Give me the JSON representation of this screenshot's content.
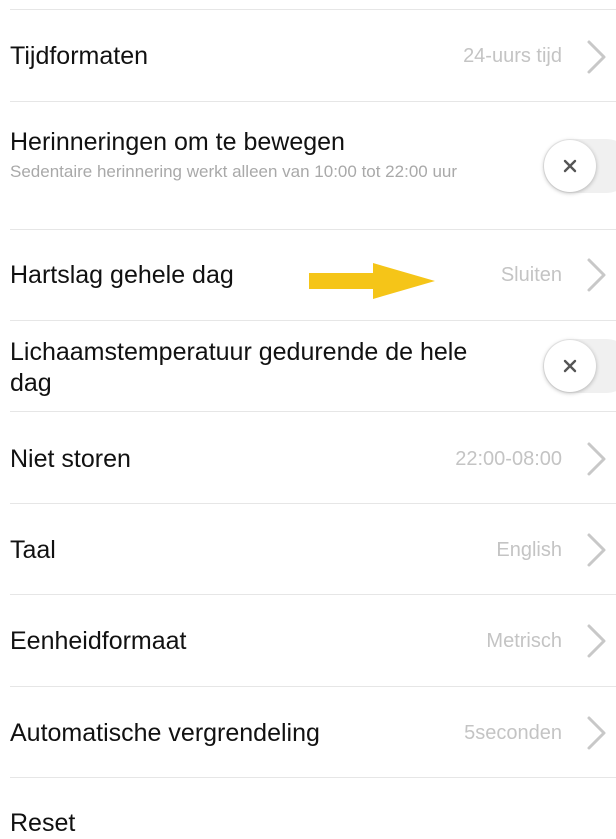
{
  "colors": {
    "accent_arrow": "#F5C518",
    "value_text": "#C4C4C4",
    "divider": "#E6E6E6",
    "toggle_bg": "#F0F0F0"
  },
  "settings": {
    "time_format": {
      "label": "Tijdformaten",
      "value": "24-uurs tijd"
    },
    "move_reminder": {
      "label": "Herinneringen om te bewegen",
      "sublabel": "Sedentaire herinnering werkt alleen van 10:00 tot 22:00 uur",
      "toggle": "off"
    },
    "heart_rate": {
      "label": "Hartslag gehele dag",
      "value": "Sluiten"
    },
    "body_temp": {
      "label": "Lichaamstemperatuur gedurende de hele dag",
      "toggle": "off"
    },
    "dnd": {
      "label": "Niet storen",
      "value": "22:00-08:00"
    },
    "language": {
      "label": "Taal",
      "value": "English"
    },
    "unit": {
      "label": "Eenheidformaat",
      "value": "Metrisch"
    },
    "autolock": {
      "label": "Automatische vergrendeling",
      "value": "5seconden"
    },
    "reset": {
      "label": "Reset"
    }
  }
}
